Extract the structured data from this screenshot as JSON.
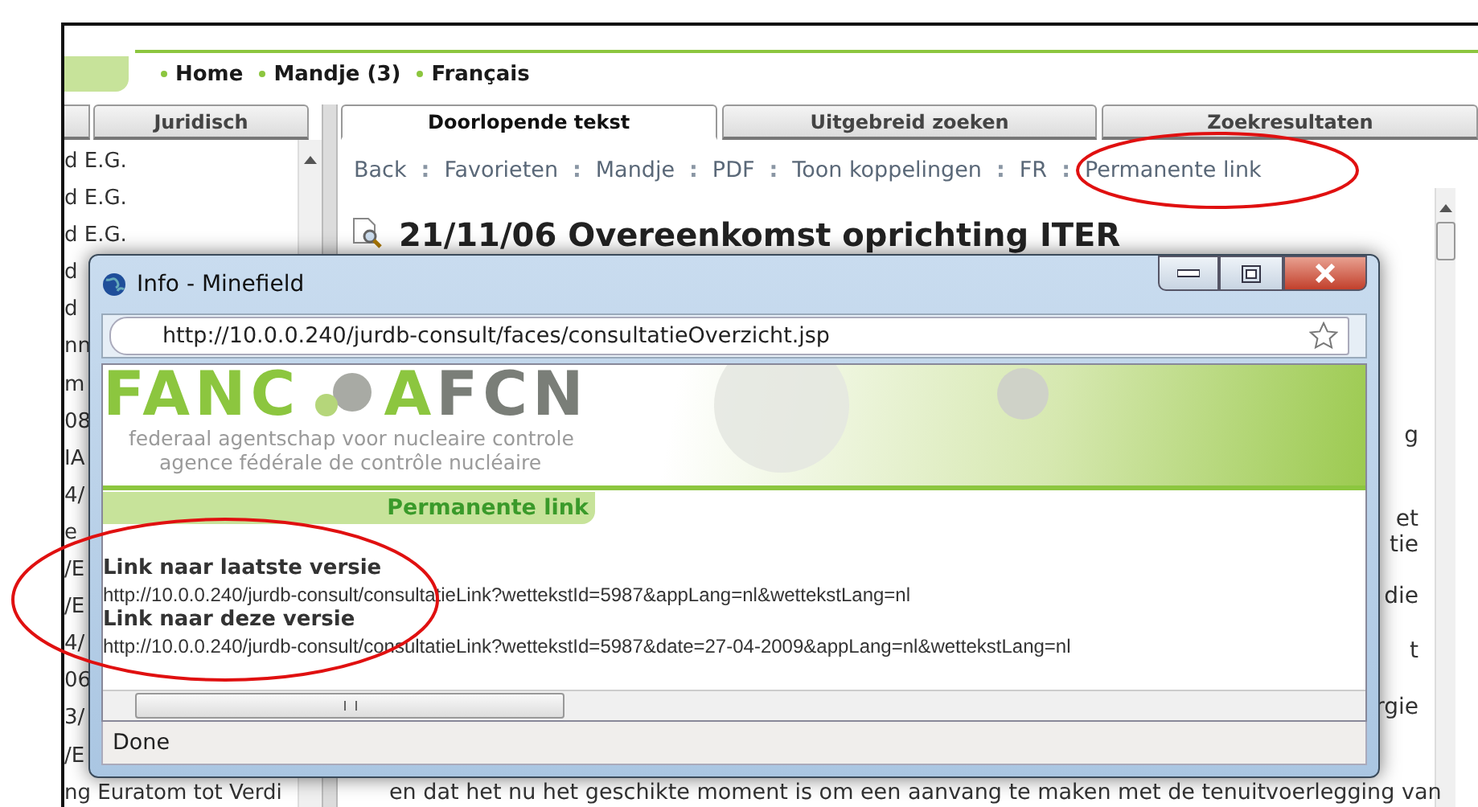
{
  "nav": {
    "items": [
      "Home",
      "Mandje (3)",
      "Français"
    ]
  },
  "left_tabs": [
    {
      "label": "Juridisch",
      "selected": false
    }
  ],
  "right_tabs": [
    {
      "label": "Doorlopende tekst",
      "selected": true
    },
    {
      "label": "Uitgebreid zoeken",
      "selected": false
    },
    {
      "label": "Zoekresultaten",
      "selected": false
    }
  ],
  "left_list": [
    "d E.G.",
    "d E.G.",
    "d E.G.",
    "d",
    "d",
    "nn",
    "m",
    "08",
    "IA",
    "4/",
    "e",
    "/E",
    "/E",
    "4/",
    "06",
    "3/",
    "/E",
    "ng Euratom tot Verdi"
  ],
  "toolbar": [
    {
      "kind": "link",
      "text": "Back"
    },
    {
      "kind": "separator",
      "text": ":"
    },
    {
      "kind": "link",
      "text": "Favorieten"
    },
    {
      "kind": "separator",
      "text": ":"
    },
    {
      "kind": "link",
      "text": "Mandje"
    },
    {
      "kind": "separator",
      "text": ":"
    },
    {
      "kind": "link",
      "text": "PDF"
    },
    {
      "kind": "separator",
      "text": ":"
    },
    {
      "kind": "link",
      "text": "Toon koppelingen"
    },
    {
      "kind": "separator",
      "text": ":"
    },
    {
      "kind": "link",
      "text": "FR"
    },
    {
      "kind": "separator",
      "text": ":"
    },
    {
      "kind": "link",
      "text": "Permanente link"
    }
  ],
  "document": {
    "title": "21/11/06 Overeenkomst oprichting ITER",
    "right_fragments": [
      "g",
      "et",
      "tie",
      "die",
      "t",
      "rgie"
    ],
    "bottom_line": "en dat het nu het geschikte moment is om een aanvang te maken met de tenuitvoerlegging van"
  },
  "popup": {
    "title": "Info - Minefield",
    "url": "http://10.0.0.240/jurdb-consult/faces/consultatieOverzicht.jsp",
    "logo": {
      "left": "FANC",
      "right": "AFCN",
      "line_1": "federaal agentschap voor nucleaire controle",
      "line_2": "agence fédérale de contrôle nucléaire"
    },
    "section_tab": "Permanente link",
    "links": [
      {
        "heading": "Link naar laatste versie",
        "url": "http://10.0.0.240/jurdb-consult/consultatieLink?wettekstId=5987&appLang=nl&wettekstLang=nl"
      },
      {
        "heading": "Link naar deze versie",
        "url": "http://10.0.0.240/jurdb-consult/consultatieLink?wettekstId=5987&date=27-04-2009&appLang=nl&wettekstLang=nl"
      }
    ],
    "status": "Done"
  }
}
